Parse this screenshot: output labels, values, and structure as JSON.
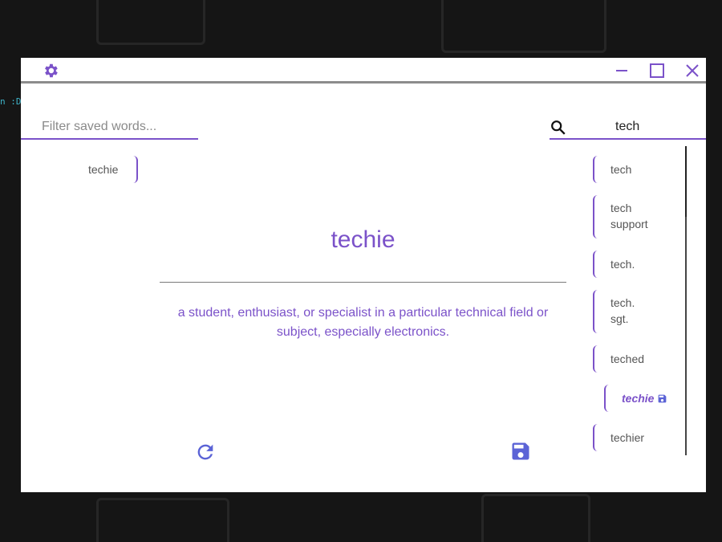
{
  "search": {
    "filter_placeholder": "Filter saved words...",
    "query": "tech"
  },
  "saved_words": [
    "techie"
  ],
  "entry": {
    "word": "techie",
    "definition": "a student, enthusiast, or specialist in a particular technical field or subject, especially electronics."
  },
  "results": [
    {
      "label": "tech"
    },
    {
      "label": "tech support"
    },
    {
      "label": "tech."
    },
    {
      "label": "tech. sgt."
    },
    {
      "label": "teched"
    },
    {
      "label": "techie",
      "selected": true,
      "saved": true
    },
    {
      "label": "techier"
    }
  ],
  "background": {
    "terminal_text": "n :D"
  },
  "icons": {
    "settings": "gear-icon",
    "minimize": "minimize-icon",
    "maximize": "maximize-icon",
    "close": "close-icon",
    "search": "search-icon",
    "refresh": "refresh-icon",
    "save": "floppy-disk-icon"
  },
  "colors": {
    "accent": "#7b52c9",
    "save_icon": "#5b63d6",
    "window_bg": "#ffffff",
    "desktop_bg": "#151515"
  }
}
